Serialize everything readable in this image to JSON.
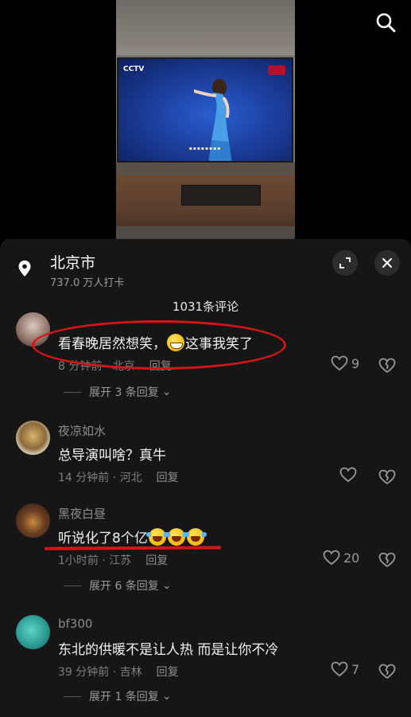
{
  "header": {
    "search_icon": "search-icon"
  },
  "location": {
    "name": "北京市",
    "checkins": "737.0 万人打卡"
  },
  "comments_header": {
    "count_label": "1031条评论"
  },
  "comments": [
    {
      "user": "",
      "text_before": "看春晚居然想笑，",
      "emoji": "grin",
      "text_after": "这事我笑了",
      "time_location": "8 分钟前 · 北京",
      "reply_label": "回复",
      "likes": "9",
      "expand_label": "展开 3 条回复"
    },
    {
      "user": "夜凉如水",
      "text": "总导演叫啥？真牛",
      "time_location": "14 分钟前 · 河北",
      "reply_label": "回复",
      "likes": ""
    },
    {
      "user": "黑夜白昼",
      "text": "听说化了8个亿",
      "emojis": [
        "cry",
        "cry",
        "cry"
      ],
      "time_location": "1小时前 · 江苏",
      "reply_label": "回复",
      "likes": "20",
      "expand_label": "展开 6 条回复"
    },
    {
      "user": "bf300",
      "text": "东北的供暖不是让人热  而是让你不冷",
      "time_location": "39 分钟前 · 吉林",
      "reply_label": "回复",
      "likes": "7",
      "expand_label": "展开 1 条回复"
    }
  ],
  "colors": {
    "sheet_bg": "#161616",
    "annotation_red": "#d51616",
    "text_primary": "#f1f1f1",
    "text_secondary": "#8c8c8c"
  },
  "tv_overlay": {
    "channel": "CCTV"
  }
}
